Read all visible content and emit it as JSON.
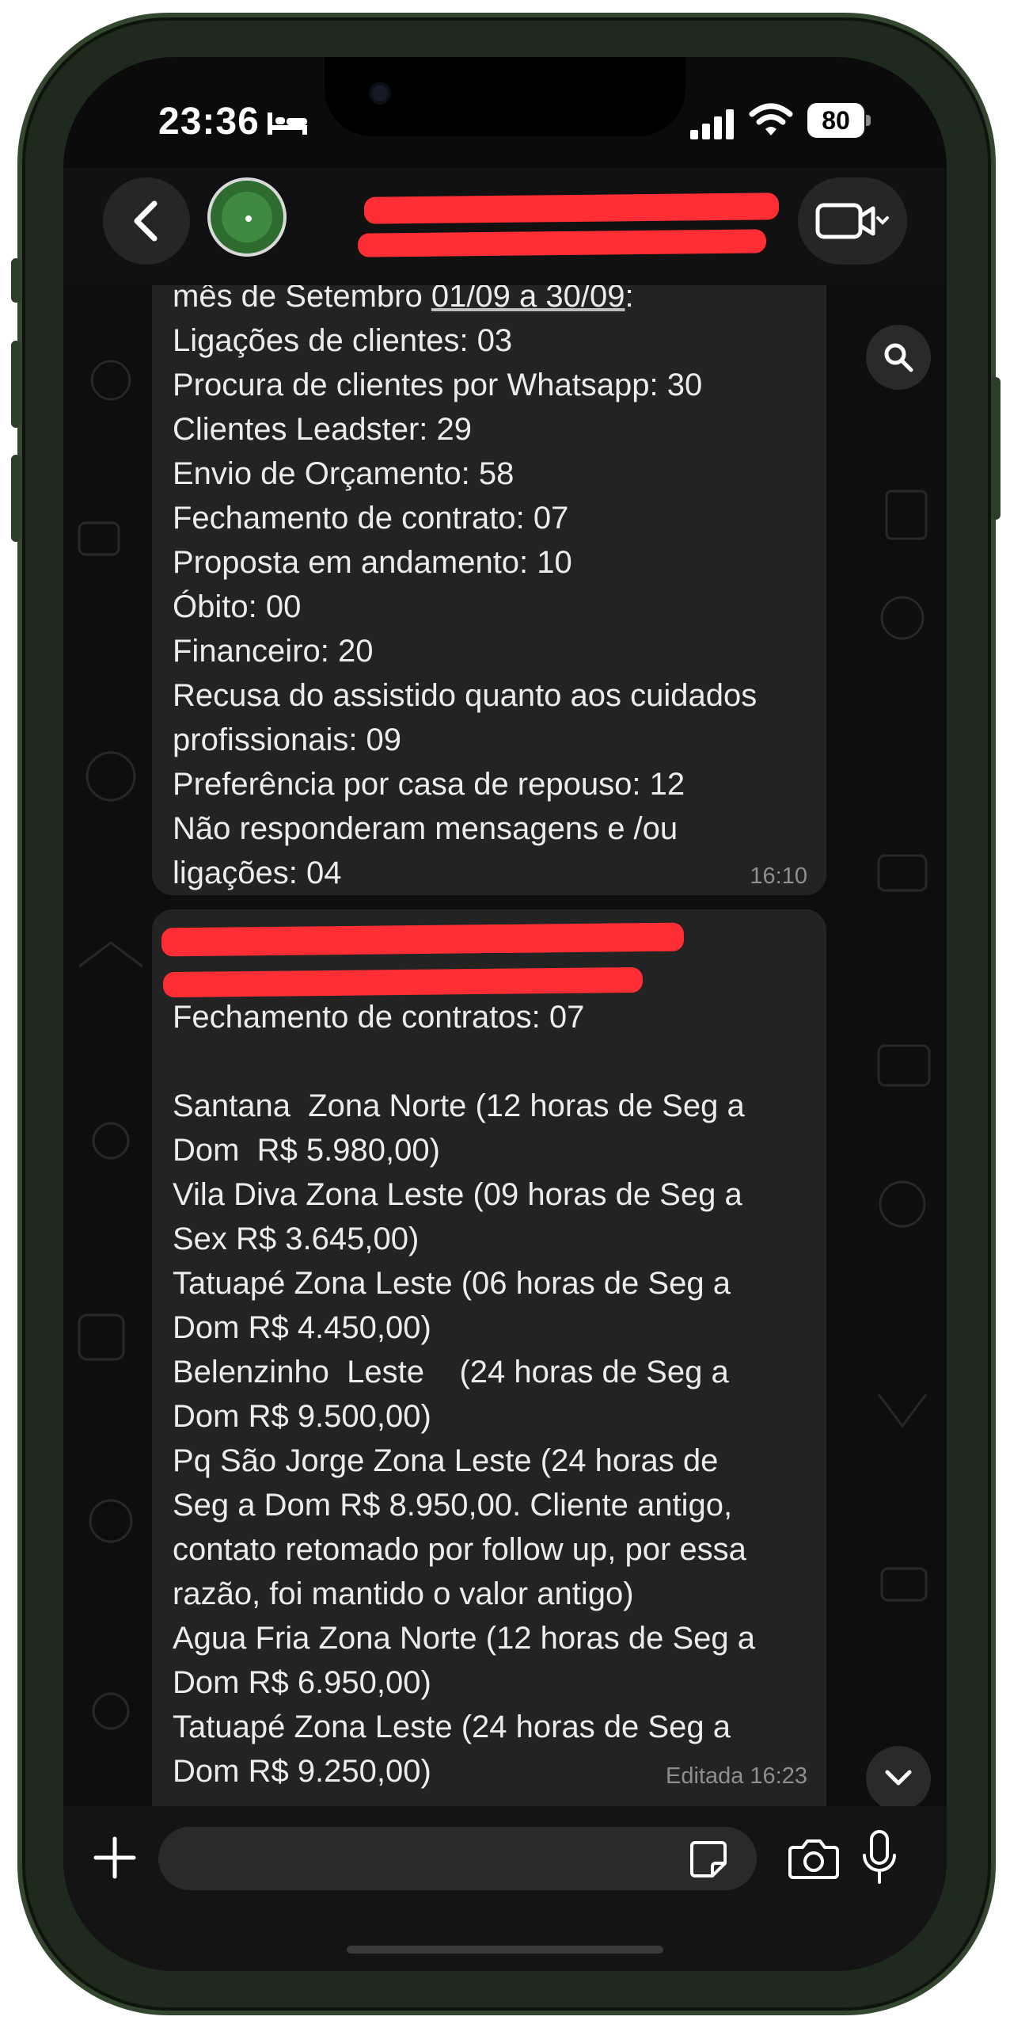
{
  "status_bar": {
    "time": "23:36",
    "battery_level": "80"
  },
  "header": {
    "contact_name": "",
    "contact_subtitle": ""
  },
  "chat": {
    "bubbles": [
      {
        "lines": [
          "mês de Setembro 01/09 a 30/09:",
          "Ligações de clientes: 03",
          "Procura de clientes por Whatsapp: 30",
          "Clientes Leadster: 29",
          "Envio de Orçamento: 58",
          "Fechamento de contrato: 07",
          "Proposta em andamento: 10",
          "Óbito: 00",
          "Financeiro: 20",
          "Recusa do assistido quanto aos cuidados",
          "profissionais: 09",
          "Preferência por casa de repouso: 12",
          "Não responderam mensagens e /ou",
          "ligações: 04"
        ],
        "time": "16:10"
      },
      {
        "lines": [
          "",
          "",
          "Fechamento de contratos: 07",
          "",
          "Santana  Zona Norte (12 horas de Seg a",
          "Dom  R$ 5.980,00)",
          "Vila Diva Zona Leste (09 horas de Seg a",
          "Sex R$ 3.645,00)",
          "Tatuapé Zona Leste (06 horas de Seg a",
          "Dom R$ 4.450,00)",
          "Belenzinho  Leste    (24 horas de Seg a",
          "Dom R$ 9.500,00)",
          "Pq São Jorge Zona Leste (24 horas de",
          "Seg a Dom R$ 8.950,00. Cliente antigo,",
          "contato retomado por follow up, por essa",
          "razão, foi mantido o valor antigo)",
          "Agua Fria Zona Norte (12 horas de Seg a",
          "Dom R$ 6.950,00)",
          "Tatuapé Zona Leste (24 horas de Seg a",
          "Dom R$ 9.250,00)"
        ],
        "time": "Editada 16:23"
      }
    ]
  },
  "input": {
    "value": "",
    "placeholder": ""
  },
  "icons": {
    "back": "chevron-left-icon",
    "video": "video-call-icon",
    "search": "search-icon",
    "scroll_down": "chevron-down-icon",
    "attach": "plus-icon",
    "sticker": "sticker-icon",
    "camera": "camera-icon",
    "mic": "microphone-icon"
  },
  "colors": {
    "bubble": "#232323",
    "redaction": "#ff2d34",
    "frame": "#1d2a1d",
    "chat_background": "#0e0e0e"
  }
}
